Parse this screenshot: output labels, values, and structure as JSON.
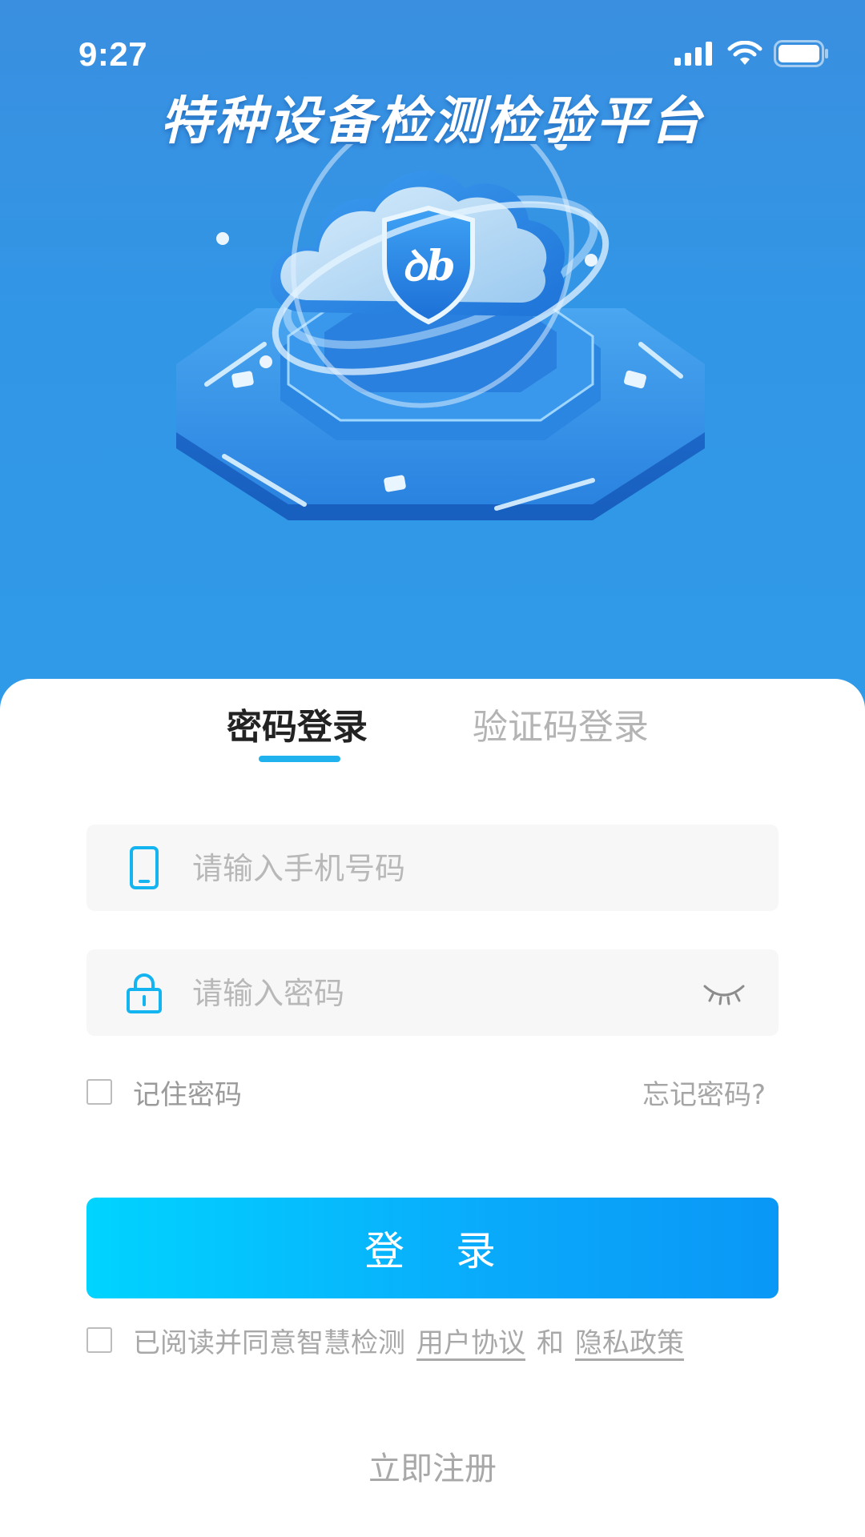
{
  "status_bar": {
    "time": "9:27"
  },
  "header": {
    "app_title": "特种设备检测检验平台"
  },
  "tabs": [
    {
      "label": "密码登录",
      "active": true
    },
    {
      "label": "验证码登录",
      "active": false
    }
  ],
  "form": {
    "phone_placeholder": "请输入手机号码",
    "phone_value": "",
    "password_placeholder": "请输入密码",
    "password_value": "",
    "remember_label": "记住密码",
    "remember_checked": false,
    "forgot_label": "忘记密码?",
    "login_label": "登 录"
  },
  "agreement": {
    "checked": false,
    "prefix": "已阅读并同意智慧检测",
    "user_agreement": "用户协议",
    "conjunction": "和",
    "privacy_policy": "隐私政策"
  },
  "footer": {
    "register_label": "立即注册"
  },
  "icons": {
    "phone": "phone-icon",
    "lock": "lock-icon",
    "eye": "eye-closed-icon",
    "signal": "cellular-signal-icon",
    "wifi": "wifi-icon",
    "battery": "battery-icon"
  },
  "colors": {
    "hero_blue": "#3296e6",
    "accent_cyan": "#1fb2ee",
    "button_start": "#00d4ff",
    "button_end": "#0a97f6",
    "muted_text": "#a8a8a8"
  }
}
